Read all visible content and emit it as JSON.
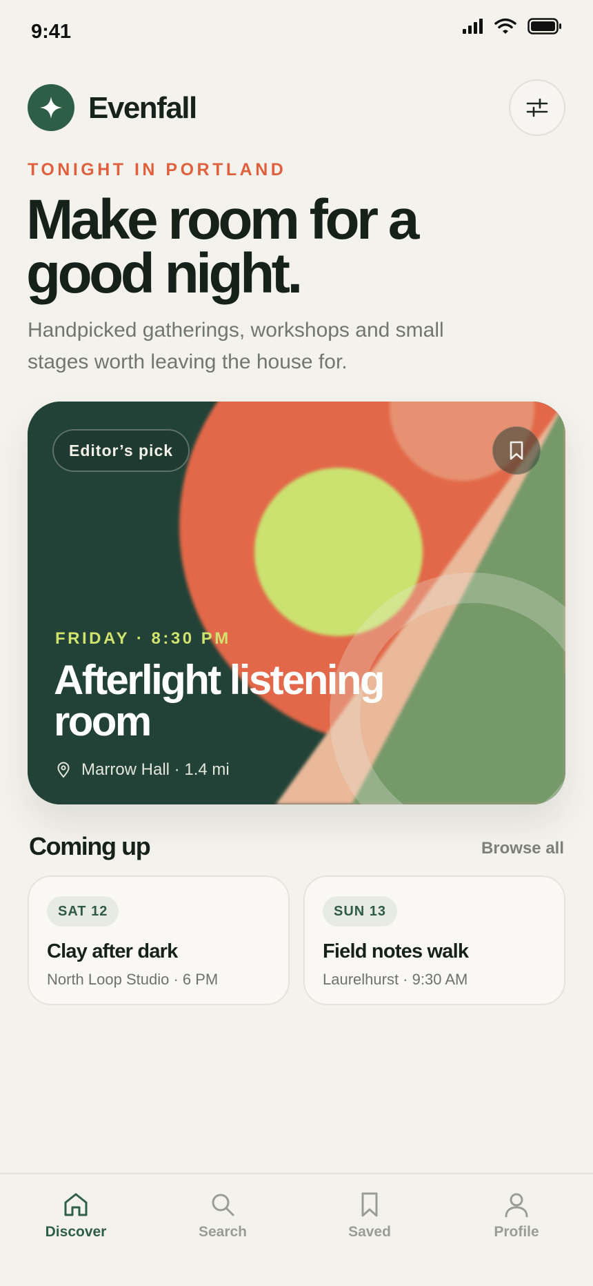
{
  "status_bar": {
    "time": "9:41"
  },
  "header": {
    "app_name": "Evenfall"
  },
  "hero": {
    "eyebrow": "TONIGHT IN PORTLAND",
    "headline": "Make room for a good night.",
    "subhead": "Handpicked gatherings, workshops and small stages worth leaving the house for."
  },
  "featured": {
    "badge": "Editor’s pick",
    "when": "FRIDAY · 8:30 PM",
    "title": "Afterlight listening room",
    "venue": "Marrow Hall · 1.4 mi"
  },
  "coming_up": {
    "title": "Coming up",
    "browse_label": "Browse all",
    "events": [
      {
        "date": "SAT 12",
        "title": "Clay after dark",
        "meta": "North Loop Studio · 6 PM"
      },
      {
        "date": "SUN 13",
        "title": "Field notes walk",
        "meta": "Laurelhurst · 9:30 AM"
      }
    ]
  },
  "tabs": [
    {
      "label": "Discover",
      "icon": "home-icon",
      "active": true
    },
    {
      "label": "Search",
      "icon": "search-icon",
      "active": false
    },
    {
      "label": "Saved",
      "icon": "bookmark-icon",
      "active": false
    },
    {
      "label": "Profile",
      "icon": "person-icon",
      "active": false
    }
  ],
  "colors": {
    "background": "#F4F2ED",
    "brand_green": "#2F5E47",
    "accent_orange": "#E0603E",
    "accent_lime": "#CFE36E",
    "card_dark": "#234237"
  }
}
